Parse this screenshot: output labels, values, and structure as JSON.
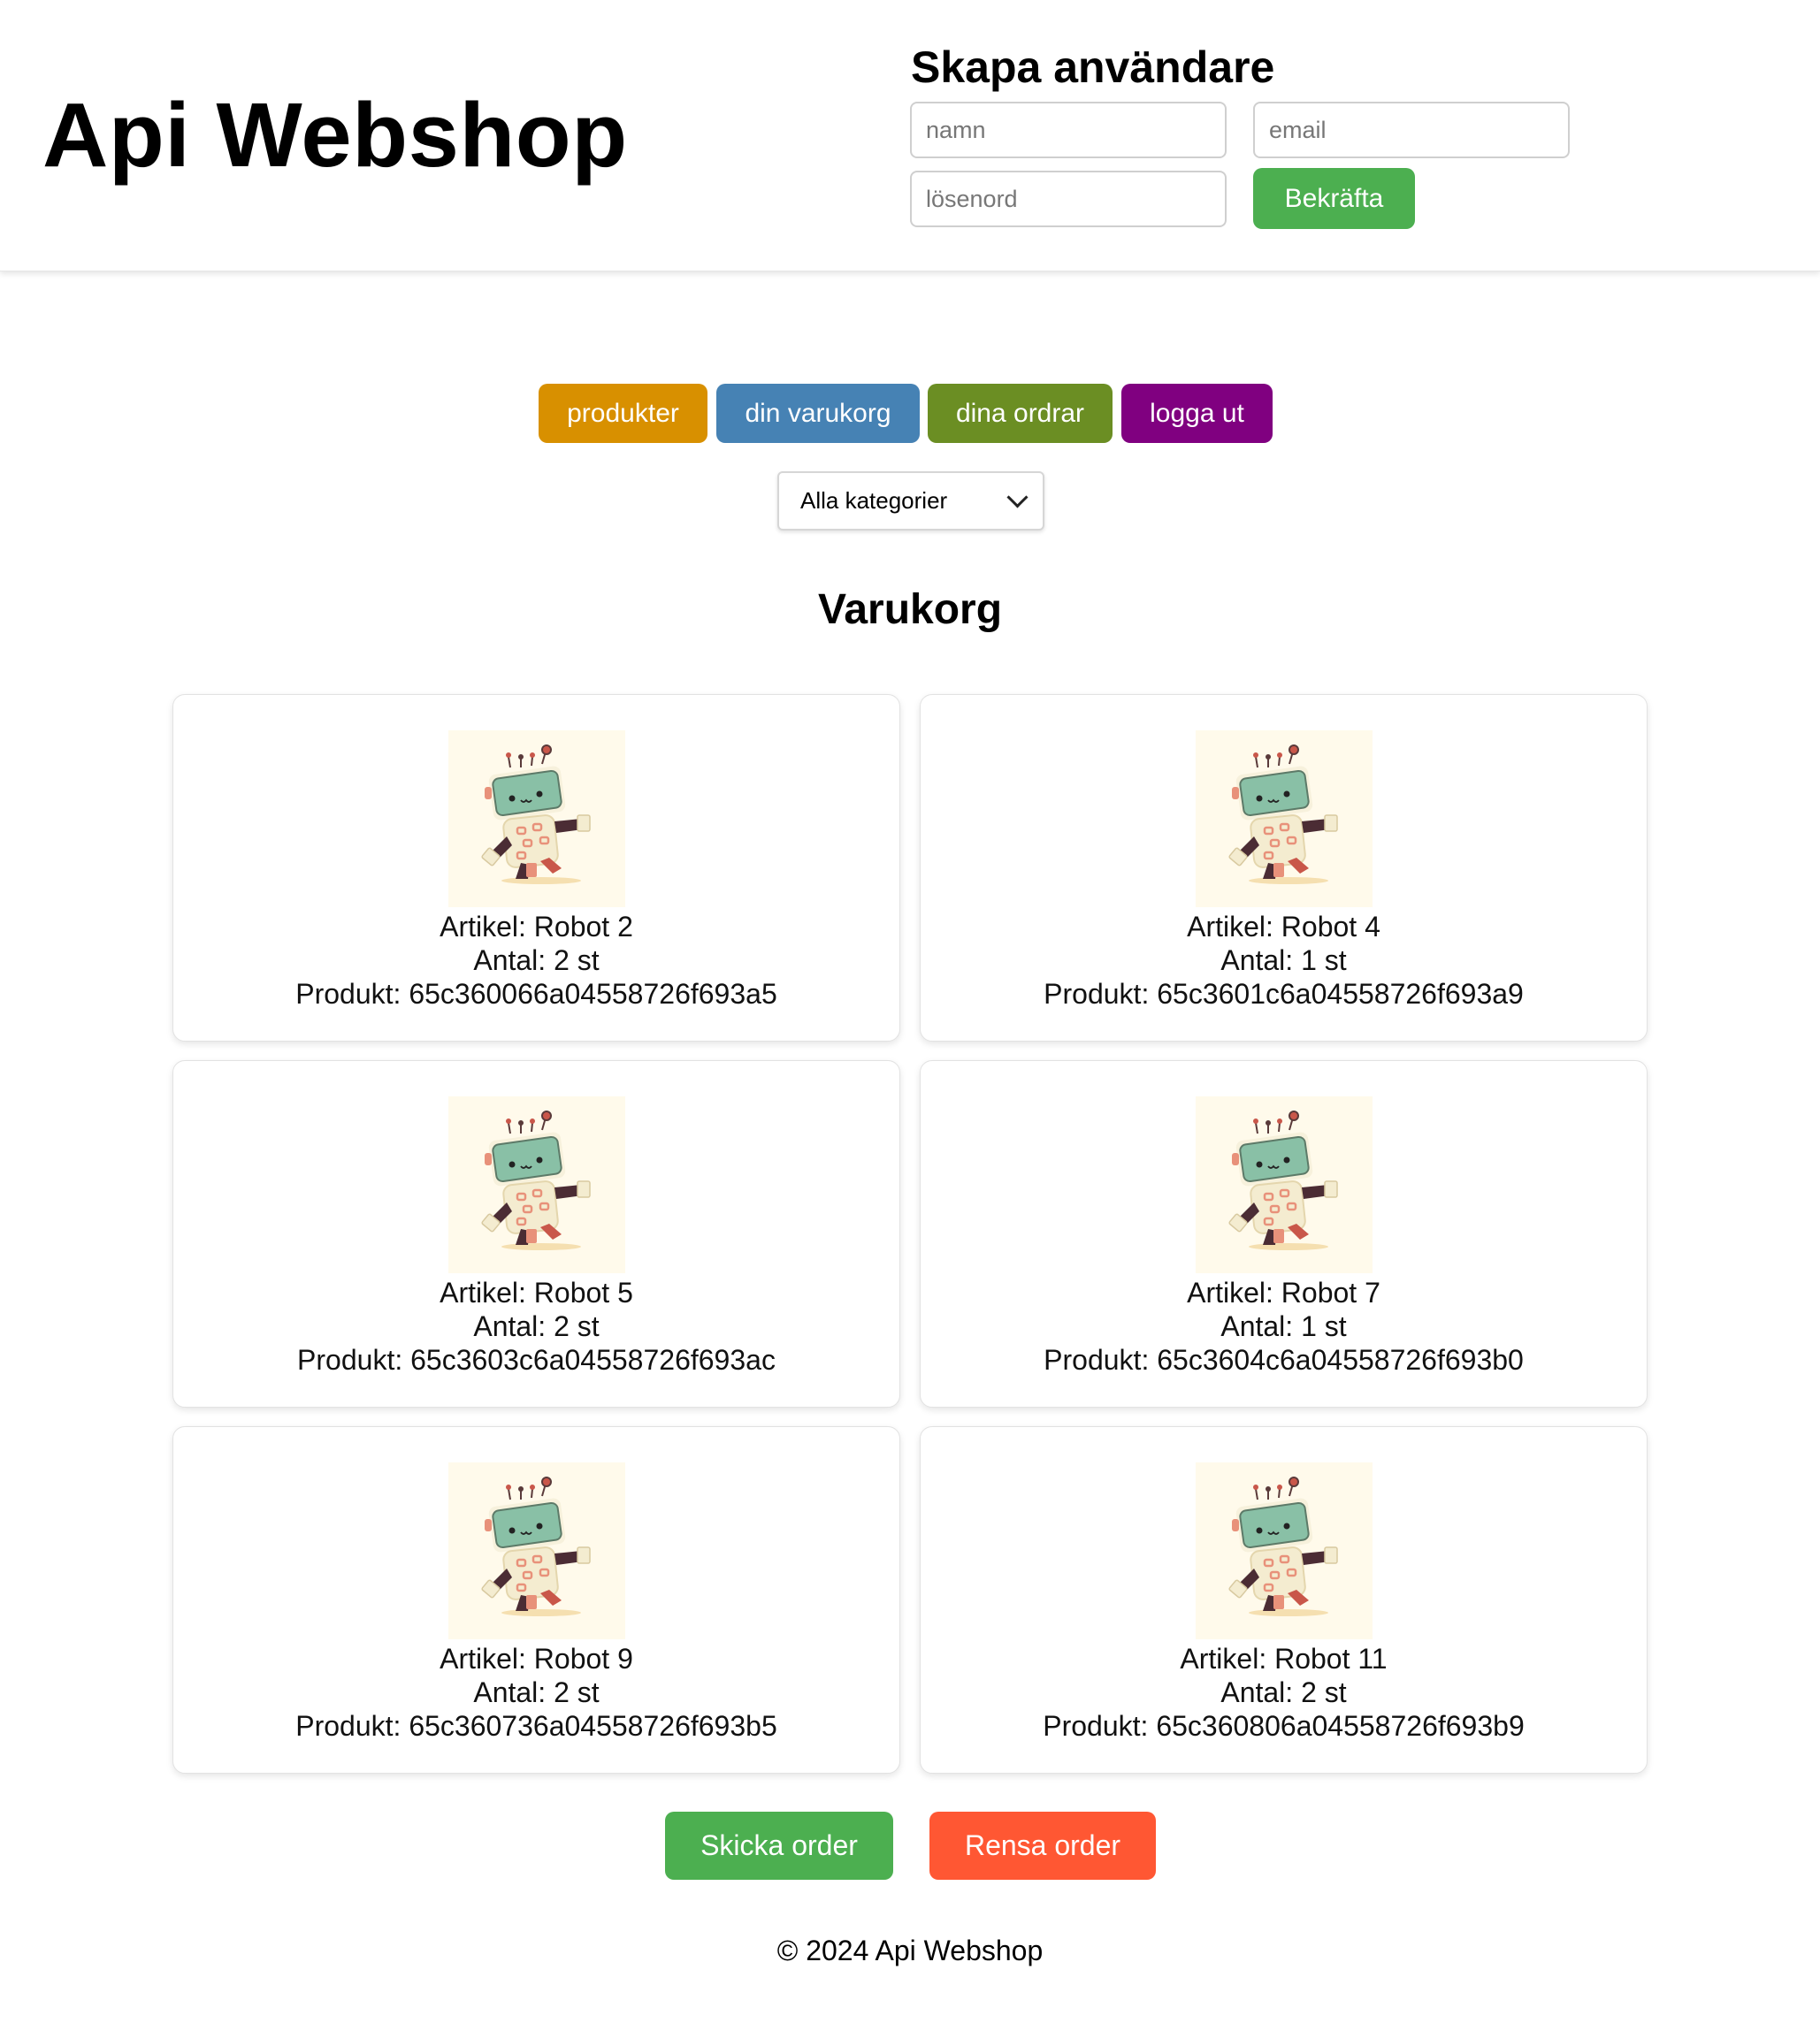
{
  "header": {
    "title": "Api Webshop",
    "register": {
      "heading": "Skapa användare",
      "name_placeholder": "namn",
      "email_placeholder": "email",
      "password_placeholder": "lösenord",
      "confirm_label": "Bekräfta"
    }
  },
  "nav": {
    "products_label": "produkter",
    "cart_label": "din varukorg",
    "orders_label": "dina ordrar",
    "logout_label": "logga ut",
    "category_selected": "Alla kategorier"
  },
  "cart": {
    "heading": "Varukorg",
    "items": [
      {
        "article": "Artikel: Robot 2",
        "quantity": "Antal: 2 st",
        "product": "Produkt: 65c360066a04558726f693a5",
        "image": "robot-image"
      },
      {
        "article": "Artikel: Robot 4",
        "quantity": "Antal: 1 st",
        "product": "Produkt: 65c3601c6a04558726f693a9",
        "image": "robot-image"
      },
      {
        "article": "Artikel: Robot 5",
        "quantity": "Antal: 2 st",
        "product": "Produkt: 65c3603c6a04558726f693ac",
        "image": "robot-image"
      },
      {
        "article": "Artikel: Robot 7",
        "quantity": "Antal: 1 st",
        "product": "Produkt: 65c3604c6a04558726f693b0",
        "image": "robot-image"
      },
      {
        "article": "Artikel: Robot 9",
        "quantity": "Antal: 2 st",
        "product": "Produkt: 65c360736a04558726f693b5",
        "image": "robot-image"
      },
      {
        "article": "Artikel: Robot 11",
        "quantity": "Antal: 2 st",
        "product": "Produkt: 65c360806a04558726f693b9",
        "image": "robot-image"
      }
    ],
    "send_label": "Skicka order",
    "clear_label": "Rensa order"
  },
  "footer": {
    "text": "© 2024 Api Webshop"
  },
  "colors": {
    "confirm": "#4caf50",
    "products": "#d89000",
    "cart": "#4682b4",
    "orders": "#6b8e23",
    "logout": "#800080",
    "send": "#4caf50",
    "clear": "#ff5733"
  }
}
